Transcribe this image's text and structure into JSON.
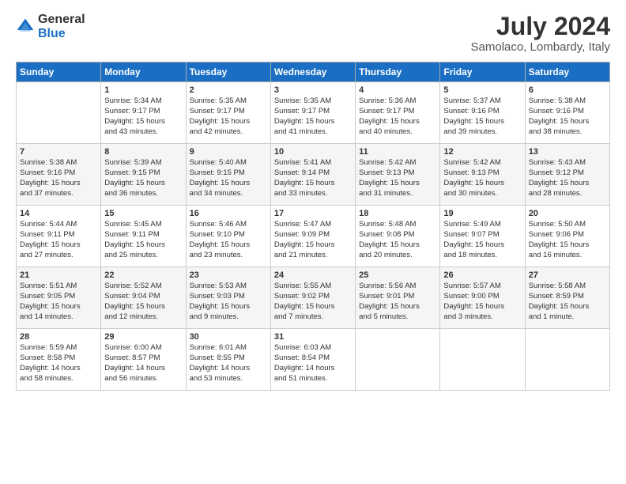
{
  "logo": {
    "general": "General",
    "blue": "Blue"
  },
  "title": "July 2024",
  "subtitle": "Samolaco, Lombardy, Italy",
  "headers": [
    "Sunday",
    "Monday",
    "Tuesday",
    "Wednesday",
    "Thursday",
    "Friday",
    "Saturday"
  ],
  "weeks": [
    [
      {
        "day": "",
        "info": ""
      },
      {
        "day": "1",
        "info": "Sunrise: 5:34 AM\nSunset: 9:17 PM\nDaylight: 15 hours\nand 43 minutes."
      },
      {
        "day": "2",
        "info": "Sunrise: 5:35 AM\nSunset: 9:17 PM\nDaylight: 15 hours\nand 42 minutes."
      },
      {
        "day": "3",
        "info": "Sunrise: 5:35 AM\nSunset: 9:17 PM\nDaylight: 15 hours\nand 41 minutes."
      },
      {
        "day": "4",
        "info": "Sunrise: 5:36 AM\nSunset: 9:17 PM\nDaylight: 15 hours\nand 40 minutes."
      },
      {
        "day": "5",
        "info": "Sunrise: 5:37 AM\nSunset: 9:16 PM\nDaylight: 15 hours\nand 39 minutes."
      },
      {
        "day": "6",
        "info": "Sunrise: 5:38 AM\nSunset: 9:16 PM\nDaylight: 15 hours\nand 38 minutes."
      }
    ],
    [
      {
        "day": "7",
        "info": "Sunrise: 5:38 AM\nSunset: 9:16 PM\nDaylight: 15 hours\nand 37 minutes."
      },
      {
        "day": "8",
        "info": "Sunrise: 5:39 AM\nSunset: 9:15 PM\nDaylight: 15 hours\nand 36 minutes."
      },
      {
        "day": "9",
        "info": "Sunrise: 5:40 AM\nSunset: 9:15 PM\nDaylight: 15 hours\nand 34 minutes."
      },
      {
        "day": "10",
        "info": "Sunrise: 5:41 AM\nSunset: 9:14 PM\nDaylight: 15 hours\nand 33 minutes."
      },
      {
        "day": "11",
        "info": "Sunrise: 5:42 AM\nSunset: 9:13 PM\nDaylight: 15 hours\nand 31 minutes."
      },
      {
        "day": "12",
        "info": "Sunrise: 5:42 AM\nSunset: 9:13 PM\nDaylight: 15 hours\nand 30 minutes."
      },
      {
        "day": "13",
        "info": "Sunrise: 5:43 AM\nSunset: 9:12 PM\nDaylight: 15 hours\nand 28 minutes."
      }
    ],
    [
      {
        "day": "14",
        "info": "Sunrise: 5:44 AM\nSunset: 9:11 PM\nDaylight: 15 hours\nand 27 minutes."
      },
      {
        "day": "15",
        "info": "Sunrise: 5:45 AM\nSunset: 9:11 PM\nDaylight: 15 hours\nand 25 minutes."
      },
      {
        "day": "16",
        "info": "Sunrise: 5:46 AM\nSunset: 9:10 PM\nDaylight: 15 hours\nand 23 minutes."
      },
      {
        "day": "17",
        "info": "Sunrise: 5:47 AM\nSunset: 9:09 PM\nDaylight: 15 hours\nand 21 minutes."
      },
      {
        "day": "18",
        "info": "Sunrise: 5:48 AM\nSunset: 9:08 PM\nDaylight: 15 hours\nand 20 minutes."
      },
      {
        "day": "19",
        "info": "Sunrise: 5:49 AM\nSunset: 9:07 PM\nDaylight: 15 hours\nand 18 minutes."
      },
      {
        "day": "20",
        "info": "Sunrise: 5:50 AM\nSunset: 9:06 PM\nDaylight: 15 hours\nand 16 minutes."
      }
    ],
    [
      {
        "day": "21",
        "info": "Sunrise: 5:51 AM\nSunset: 9:05 PM\nDaylight: 15 hours\nand 14 minutes."
      },
      {
        "day": "22",
        "info": "Sunrise: 5:52 AM\nSunset: 9:04 PM\nDaylight: 15 hours\nand 12 minutes."
      },
      {
        "day": "23",
        "info": "Sunrise: 5:53 AM\nSunset: 9:03 PM\nDaylight: 15 hours\nand 9 minutes."
      },
      {
        "day": "24",
        "info": "Sunrise: 5:55 AM\nSunset: 9:02 PM\nDaylight: 15 hours\nand 7 minutes."
      },
      {
        "day": "25",
        "info": "Sunrise: 5:56 AM\nSunset: 9:01 PM\nDaylight: 15 hours\nand 5 minutes."
      },
      {
        "day": "26",
        "info": "Sunrise: 5:57 AM\nSunset: 9:00 PM\nDaylight: 15 hours\nand 3 minutes."
      },
      {
        "day": "27",
        "info": "Sunrise: 5:58 AM\nSunset: 8:59 PM\nDaylight: 15 hours\nand 1 minute."
      }
    ],
    [
      {
        "day": "28",
        "info": "Sunrise: 5:59 AM\nSunset: 8:58 PM\nDaylight: 14 hours\nand 58 minutes."
      },
      {
        "day": "29",
        "info": "Sunrise: 6:00 AM\nSunset: 8:57 PM\nDaylight: 14 hours\nand 56 minutes."
      },
      {
        "day": "30",
        "info": "Sunrise: 6:01 AM\nSunset: 8:55 PM\nDaylight: 14 hours\nand 53 minutes."
      },
      {
        "day": "31",
        "info": "Sunrise: 6:03 AM\nSunset: 8:54 PM\nDaylight: 14 hours\nand 51 minutes."
      },
      {
        "day": "",
        "info": ""
      },
      {
        "day": "",
        "info": ""
      },
      {
        "day": "",
        "info": ""
      }
    ]
  ]
}
